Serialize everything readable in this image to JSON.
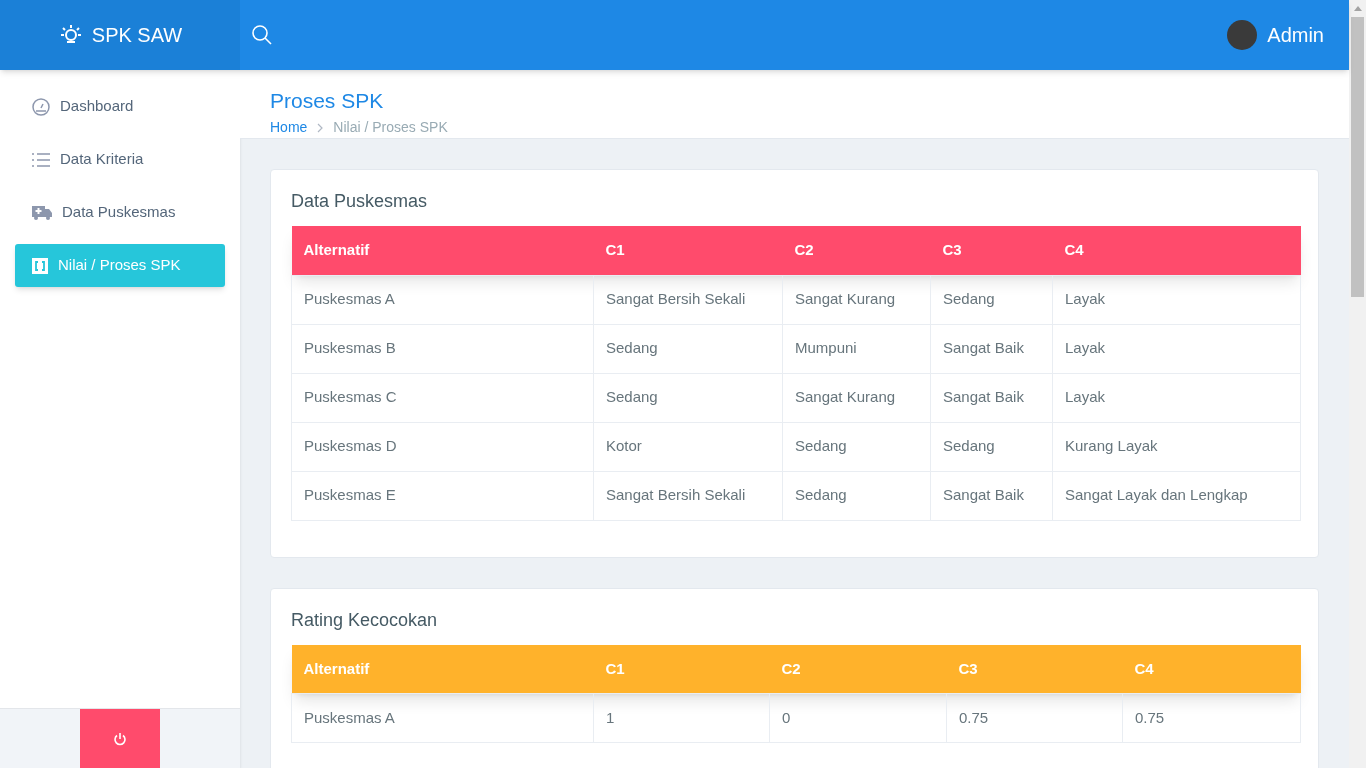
{
  "brand": {
    "title": "SPK SAW"
  },
  "user": {
    "name": "Admin"
  },
  "sidebar": {
    "items": [
      {
        "label": "Dashboard",
        "selected": false
      },
      {
        "label": "Data Kriteria",
        "selected": false
      },
      {
        "label": "Data Puskesmas",
        "selected": false
      },
      {
        "label": "Nilai / Proses SPK",
        "selected": true
      }
    ]
  },
  "page": {
    "title": "Proses SPK",
    "breadcrumb": [
      {
        "label": "Home",
        "link": true
      },
      {
        "label": "Nilai / Proses SPK",
        "link": false
      }
    ]
  },
  "cards": [
    {
      "title": "Data Puskesmas",
      "columns": [
        "Alternatif",
        "C1",
        "C2",
        "C3",
        "C4"
      ],
      "rows": [
        [
          "Puskesmas A",
          "Sangat Bersih Sekali",
          "Sangat Kurang",
          "Sedang",
          "Layak"
        ],
        [
          "Puskesmas B",
          "Sedang",
          "Mumpuni",
          "Sangat Baik",
          "Layak"
        ],
        [
          "Puskesmas C",
          "Sedang",
          "Sangat Kurang",
          "Sangat Baik",
          "Layak"
        ],
        [
          "Puskesmas D",
          "Kotor",
          "Sedang",
          "Sedang",
          "Kurang Layak"
        ],
        [
          "Puskesmas E",
          "Sangat Bersih Sekali",
          "Sedang",
          "Sangat Baik",
          "Sangat Layak dan Lengkap"
        ]
      ]
    },
    {
      "title": "Rating Kecocokan",
      "columns": [
        "Alternatif",
        "C1",
        "C2",
        "C3",
        "C4"
      ],
      "rows": [
        [
          "Puskesmas A",
          "1",
          "0",
          "0.75",
          "0.75"
        ]
      ]
    }
  ]
}
